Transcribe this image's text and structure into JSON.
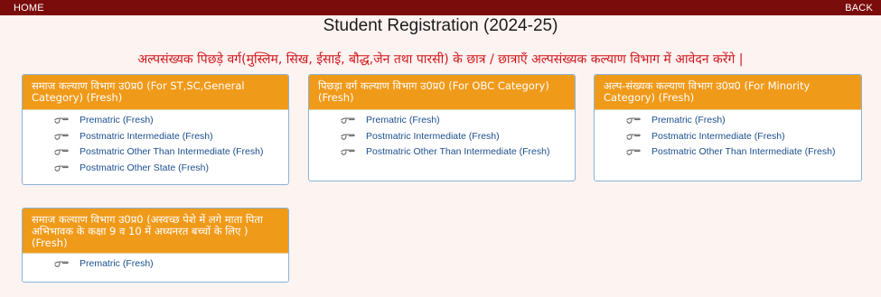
{
  "nav": {
    "home": "HOME",
    "back": "BACK"
  },
  "header": {
    "title": "Student Registration (2024-25)",
    "notice": "अल्पसंख्यक पिछड़े वर्ग(मुस्लिम, सिख, ईसाई, बौद्ध,जेन तथा पारसी) के छात्र / छात्राएँ अल्पसंख्यक कल्याण विभाग में आवेदन करेंगे |"
  },
  "cards": [
    {
      "title": "समाज कल्याण विभाग उ0प्र0 (For ST,SC,General Category) (Fresh)",
      "links": [
        "Prematric (Fresh)",
        "Postmatric Intermediate (Fresh)",
        "Postmatric Other Than Intermediate (Fresh)",
        "Postmatric Other State (Fresh)"
      ]
    },
    {
      "title": "पिछड़ा वर्ग कल्याण विभाग उ0प्र0 (For OBC Category) (Fresh)",
      "links": [
        "Prematric (Fresh)",
        "Postmatric Intermediate (Fresh)",
        "Postmatric Other Than Intermediate (Fresh)"
      ]
    },
    {
      "title": "अल्प-संख्यक कल्याण विभाग उ0प्र0 (For Minority Category) (Fresh)",
      "links": [
        "Prematric (Fresh)",
        "Postmatric Intermediate (Fresh)",
        "Postmatric Other Than Intermediate (Fresh)"
      ]
    },
    {
      "title": "समाज कल्याण विभाग उ0प्र0 (अस्वच्छ पेशे में लगे माता पिता अभिभावक के कक्षा 9 व 10 में अध्यनरत बच्चों के लिए ) (Fresh)",
      "links": [
        "Prematric (Fresh)"
      ]
    }
  ],
  "icons": {
    "link_bullet": "pointing-hand-icon"
  },
  "colors": {
    "topbar": "#7b0c0c",
    "card_header": "#f09a1a",
    "notice": "#d0161c",
    "link": "#1b4f8f"
  }
}
